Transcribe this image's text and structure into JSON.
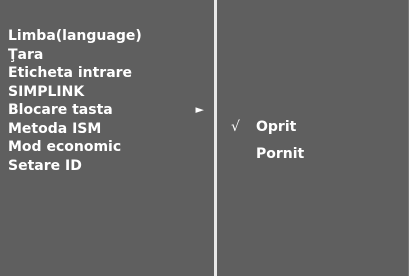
{
  "menu": {
    "items": [
      {
        "label": "Limba(language)"
      },
      {
        "label": "Ţara"
      },
      {
        "label": "Eticheta intrare"
      },
      {
        "label": "SIMPLINK"
      },
      {
        "label": "Blocare tasta",
        "arrow": "►"
      },
      {
        "label": "Metoda ISM"
      },
      {
        "label": "Mod economic"
      },
      {
        "label": "Setare ID"
      }
    ]
  },
  "submenu": {
    "items": [
      {
        "label": "Oprit",
        "check": "√"
      },
      {
        "label": "Pornit",
        "check": ""
      }
    ]
  }
}
